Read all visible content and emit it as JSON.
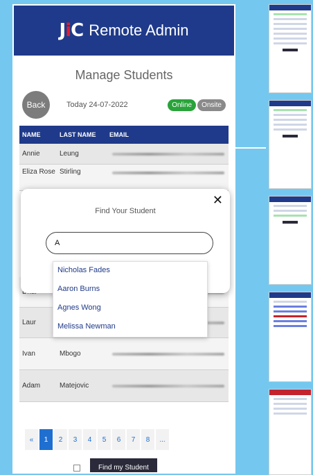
{
  "app": {
    "brand": "JiC",
    "title": "Remote Admin"
  },
  "page": {
    "title": "Manage Students",
    "back": "Back",
    "today": "Today 24-07-2022",
    "online": "Online",
    "onsite": "Onsite"
  },
  "table": {
    "headers": [
      "NAME",
      "LAST NAME",
      "EMAIL"
    ],
    "rows": [
      {
        "name": "Annie",
        "last": "Leung"
      },
      {
        "name": "Eliza Rose",
        "last": "Stirling"
      },
      {
        "name": "Dhur",
        "last": ""
      },
      {
        "name": "Laur",
        "last": ""
      },
      {
        "name": "Ivan",
        "last": "Mbogo"
      },
      {
        "name": "Adam",
        "last": "Matejovic"
      }
    ]
  },
  "modal": {
    "title": "Find Your Student",
    "search_value": "A",
    "suggestions": [
      "Nicholas Fades",
      "Aaron Burns",
      "Agnes Wong",
      "Melissa Newman"
    ]
  },
  "pagination": [
    "«",
    "1",
    "2",
    "3",
    "4",
    "5",
    "6",
    "7",
    "8",
    "..."
  ],
  "footer": {
    "find_button": "Find my Student"
  },
  "colors": {
    "header": "#1f3a8a",
    "online": "#29a33a",
    "background": "#74c8ef"
  }
}
